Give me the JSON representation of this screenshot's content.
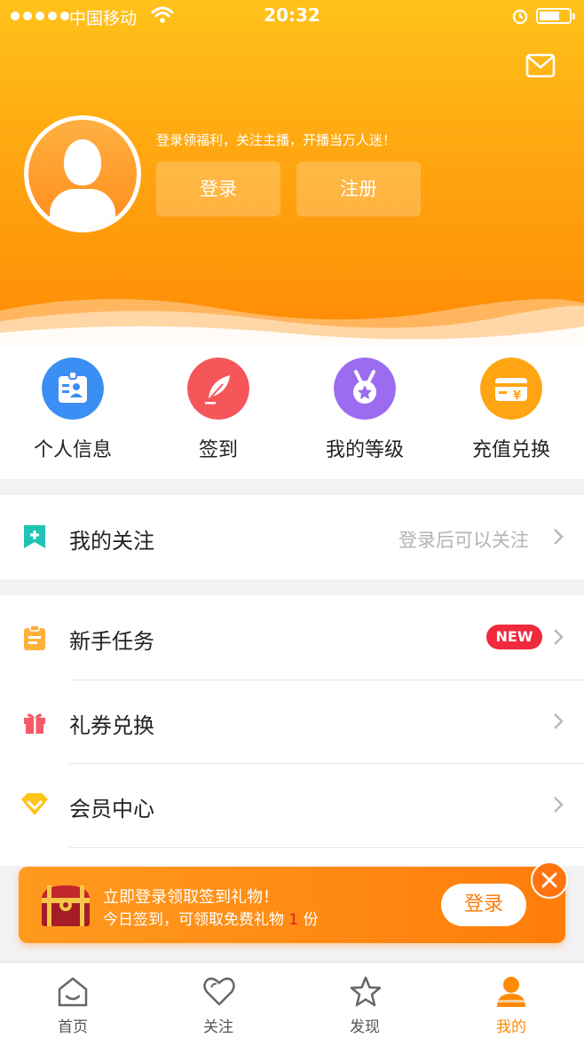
{
  "status_bar": {
    "carrier": "中国移动",
    "time": "20:32"
  },
  "header": {
    "tagline": "登录领福利，关注主播，开播当万人迷！",
    "login_label": "登录",
    "register_label": "注册"
  },
  "quick_actions": [
    {
      "label": "个人信息",
      "icon": "id-card-icon",
      "color": "#3b8ef3"
    },
    {
      "label": "签到",
      "icon": "feather-icon",
      "color": "#f5565a"
    },
    {
      "label": "我的等级",
      "icon": "medal-icon",
      "color": "#9b6cf0"
    },
    {
      "label": "充值兑换",
      "icon": "recharge-card-icon",
      "color": "#ffa514"
    }
  ],
  "follow": {
    "label": "我的关注",
    "hint": "登录后可以关注"
  },
  "menu": [
    {
      "label": "新手任务",
      "badge": "NEW"
    },
    {
      "label": "礼券兑换"
    },
    {
      "label": "会员中心"
    }
  ],
  "banner": {
    "line1": "立即登录领取签到礼物！",
    "line2_prefix": "今日签到，可领取免费礼物 ",
    "line2_count": "1",
    "line2_suffix": " 份",
    "login_label": "登录"
  },
  "tabbar": [
    {
      "label": "首页"
    },
    {
      "label": "关注"
    },
    {
      "label": "发现"
    },
    {
      "label": "我的",
      "active": true
    }
  ],
  "colors": {
    "accent": "#ff8a06",
    "badge_red": "#f0293d"
  }
}
